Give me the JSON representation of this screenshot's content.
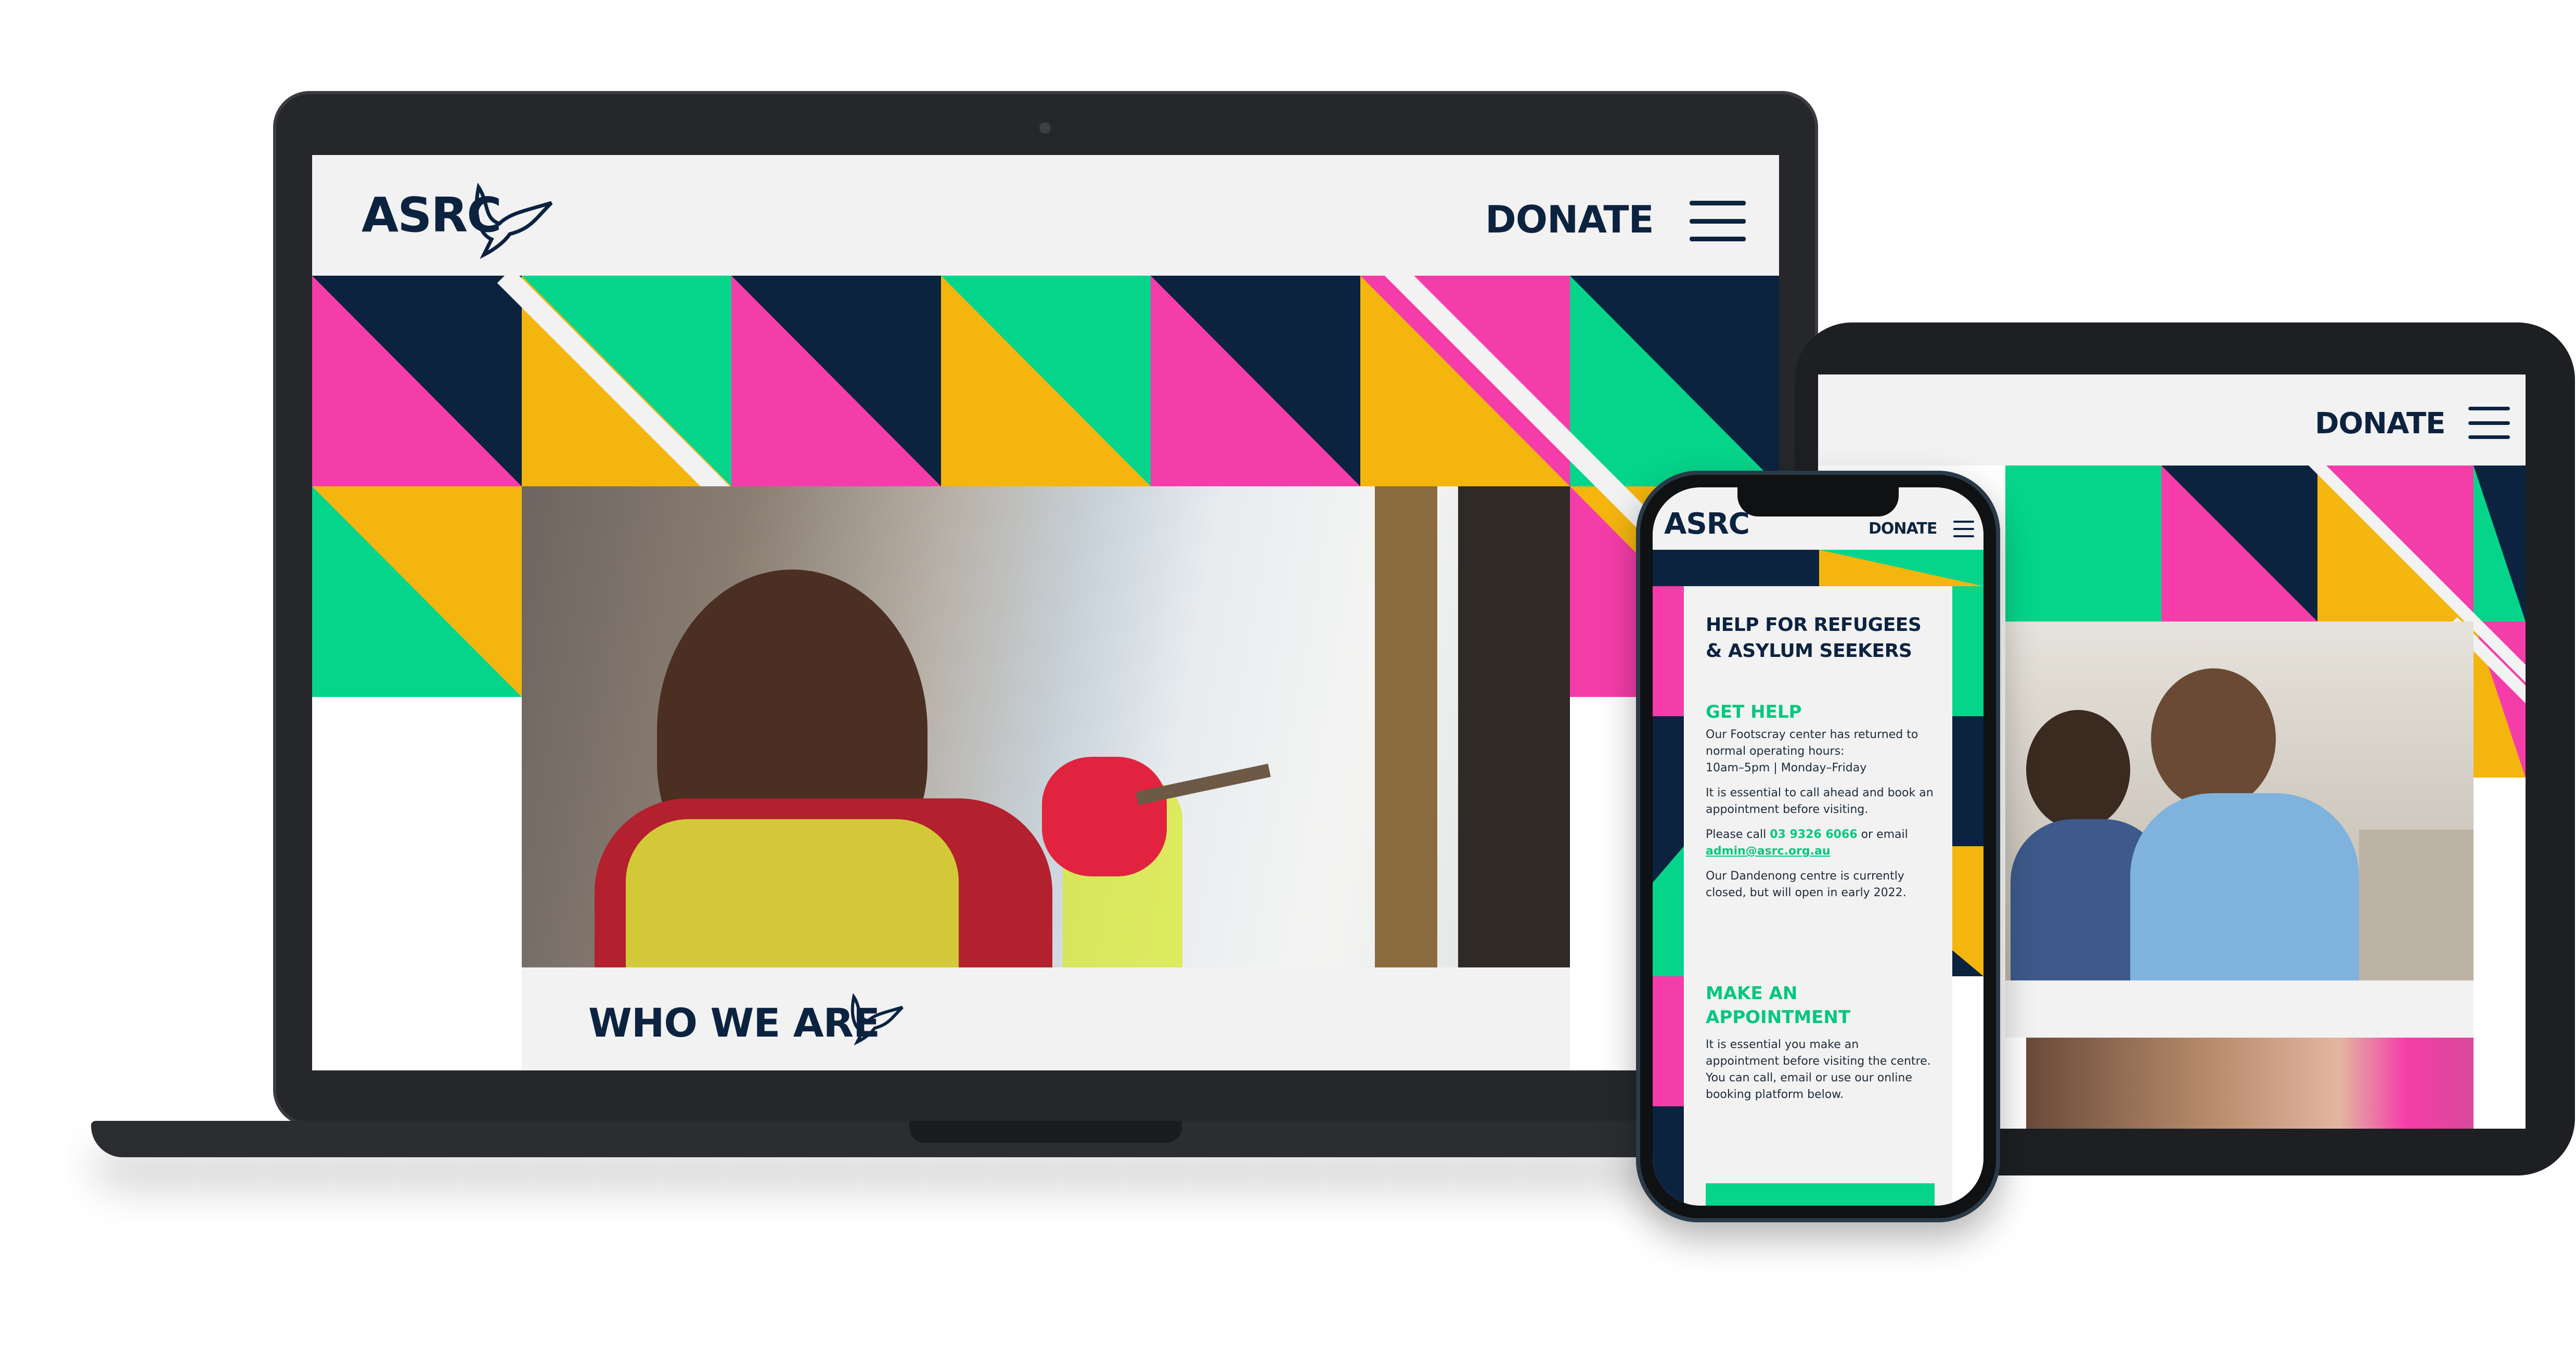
{
  "colors": {
    "navy": "#0c2340",
    "green": "#05d58b",
    "pink": "#f53da9",
    "yellow": "#f4b50f",
    "light": "#f2f2f2",
    "link_green": "#05c77f"
  },
  "laptop": {
    "logo": "ASRC",
    "donate_label": "DONATE",
    "menu_icon": "hamburger-menu-icon",
    "dove_icon": "dove-icon",
    "section_title": "WHO WE ARE"
  },
  "tablet": {
    "donate_label": "DONATE",
    "menu_icon": "hamburger-menu-icon"
  },
  "phone": {
    "logo": "ASRC",
    "donate_label": "DONATE",
    "title_line1": "HELP FOR REFUGEES",
    "title_line2": "& ASYLUM SEEKERS",
    "get_help": {
      "heading": "GET HELP",
      "p1": "Our Footscray center has returned to normal operating hours:",
      "p1b": "10am–5pm | Monday–Friday",
      "p2": "It is essential to call ahead and book an appointment before visiting.",
      "p3_prefix": "Please call ",
      "phone": "03 9326 6066",
      "p3_mid": " or email ",
      "email": "admin@asrc.org.au",
      "p4": "Our Dandenong centre is currently closed, but will open in early 2022."
    },
    "appointment": {
      "heading_line1": "MAKE AN",
      "heading_line2": "APPOINTMENT",
      "p1": "It is essential you make an appointment before visiting the centre. You can call, email or use our online booking platform below."
    }
  }
}
